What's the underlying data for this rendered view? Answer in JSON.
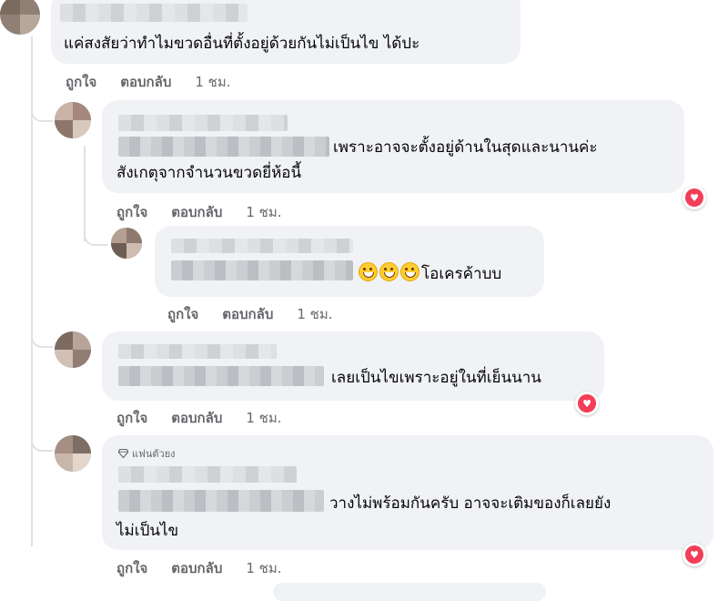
{
  "comments": [
    {
      "text_lines": [
        "แค่สงสัยว่าทำไมขวดอื่นที่ตั้งอยู่ด้วยกันไม่เป็นไข ได้ปะ"
      ],
      "like_label": "ถูกใจ",
      "reply_label": "ตอบกลับ",
      "time": "1 ชม."
    },
    {
      "text_lines": [
        "เพราะอาจจะตั้งอยู่ด้านในสุดและนานค่ะ",
        "สังเกตุจากจำนวนขวดยี่ห้อนี้"
      ],
      "like_label": "ถูกใจ",
      "reply_label": "ตอบกลับ",
      "time": "1 ชม."
    },
    {
      "text_lines": [
        "โอเครค้าบบ"
      ],
      "like_label": "ถูกใจ",
      "reply_label": "ตอบกลับ",
      "time": "1 ชม."
    },
    {
      "text_lines": [
        "เลยเป็นไขเพราะอยู่ในที่เย็นนาน"
      ],
      "like_label": "ถูกใจ",
      "reply_label": "ตอบกลับ",
      "time": "1 ชม."
    },
    {
      "badge": "แฟนตัวยง",
      "text_lines": [
        "วางไม่พร้อมกันครับ อาจจะเติมของก็เลยยัง",
        "ไม่เป็นไข"
      ],
      "like_label": "ถูกใจ",
      "reply_label": "ตอบกลับ",
      "time": "1 ชม."
    }
  ],
  "colors": {
    "bubble": "#f0f2f5",
    "meta_text": "#65676b",
    "love_reaction": "#f33e58"
  }
}
